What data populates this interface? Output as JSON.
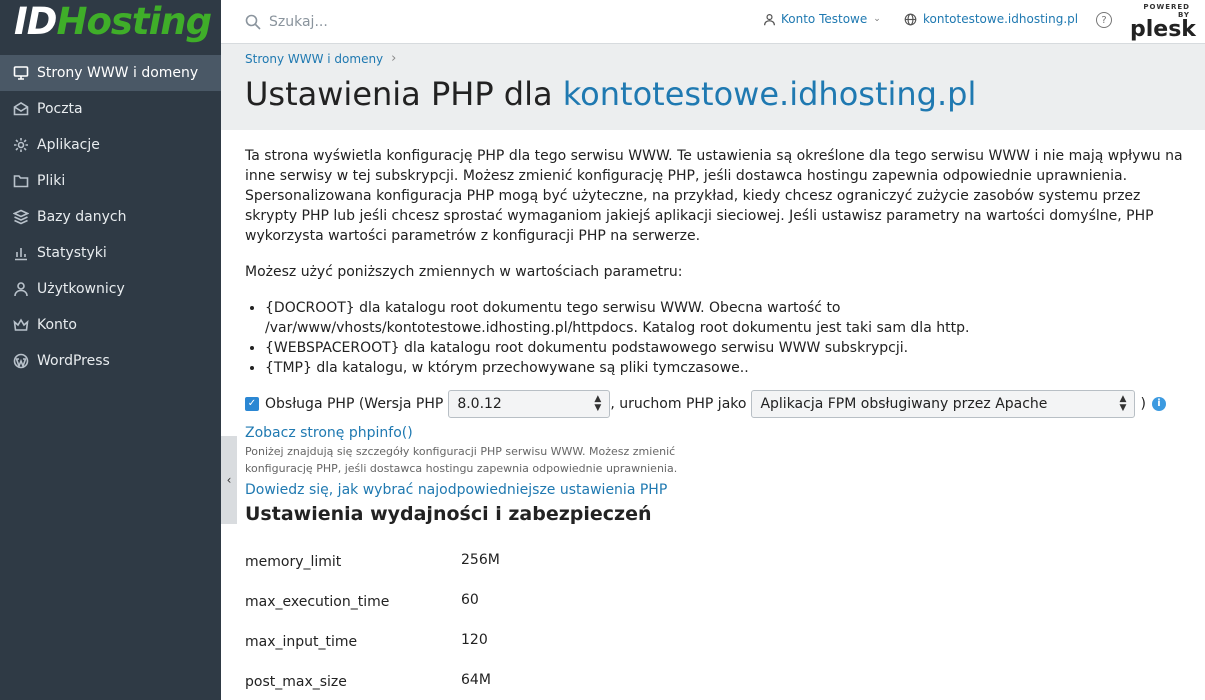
{
  "brand": {
    "logo_part1": "ID",
    "logo_part2": "Hosting"
  },
  "sidebar": {
    "items": [
      {
        "label": "Strony WWW i domeny",
        "icon": "monitor-icon",
        "active": true
      },
      {
        "label": "Poczta",
        "icon": "mail-icon"
      },
      {
        "label": "Aplikacje",
        "icon": "gear-icon"
      },
      {
        "label": "Pliki",
        "icon": "folder-icon"
      },
      {
        "label": "Bazy danych",
        "icon": "database-icon"
      },
      {
        "label": "Statystyki",
        "icon": "bar-chart-icon"
      },
      {
        "label": "Użytkownicy",
        "icon": "user-icon"
      },
      {
        "label": "Konto",
        "icon": "crown-icon"
      },
      {
        "label": "WordPress",
        "icon": "wordpress-icon"
      }
    ]
  },
  "header": {
    "search_placeholder": "Szukaj...",
    "account_label": "Konto Testowe",
    "domain_label": "kontotestowe.idhosting.pl",
    "help_glyph": "?",
    "plesk_powered": "POWERED BY",
    "plesk_name": "plesk"
  },
  "breadcrumb": {
    "item": "Strony WWW i domeny"
  },
  "title": {
    "prefix": "Ustawienia PHP dla ",
    "domain": "kontotestowe.idhosting.pl"
  },
  "intro": "Ta strona wyświetla konfigurację PHP dla tego serwisu WWW. Te ustawienia są określone dla tego serwisu WWW i nie mają wpływu na inne serwisy w tej subskrypcji. Możesz zmienić konfigurację PHP, jeśli dostawca hostingu zapewnia odpowiednie uprawnienia. Spersonalizowana konfiguracja PHP mogą być użyteczne, na przykład, kiedy chcesz ograniczyć zużycie zasobów systemu przez skrypty PHP lub jeśli chcesz sprostać wymaganiom jakiejś aplikacji sieciowej. Jeśli ustawisz parametry na wartości domyślne, PHP wykorzysta wartości parametrów z konfiguracji PHP na serwerze.",
  "vars_intro": "Możesz użyć poniższych zmiennych w wartościach parametru:",
  "vars": [
    "{DOCROOT} dla katalogu root dokumentu tego serwisu WWW. Obecna wartość to /var/www/vhosts/kontotestowe.idhosting.pl/httpdocs. Katalog root dokumentu jest taki sam dla http.",
    "{WEBSPACEROOT} dla katalogu root dokumentu podstawowego serwisu WWW subskrypcji.",
    "{TMP} dla katalogu, w którym przechowywane są pliki tymczasowe.."
  ],
  "php": {
    "support_label": "Obsługa PHP (Wersja PHP",
    "version": "8.0.12",
    "run_label": ", uruchom PHP jako",
    "handler": "Aplikacja FPM obsługiwany przez Apache",
    "close_paren": ")",
    "phpinfo_link": "Zobacz stronę phpinfo()",
    "hint": "Poniżej znajdują się szczegóły konfiguracji PHP serwisu WWW. Możesz zmienić konfigurację PHP, jeśli dostawca hostingu zapewnia odpowiednie uprawnienia.",
    "learn_link": "Dowiedz się, jak wybrać najodpowiedniejsze ustawienia PHP"
  },
  "section": {
    "title": "Ustawienia wydajności i zabezpieczeń",
    "params": [
      {
        "key": "memory_limit",
        "value": "256M"
      },
      {
        "key": "max_execution_time",
        "value": "60"
      },
      {
        "key": "max_input_time",
        "value": "120"
      },
      {
        "key": "post_max_size",
        "value": "64M"
      }
    ]
  }
}
